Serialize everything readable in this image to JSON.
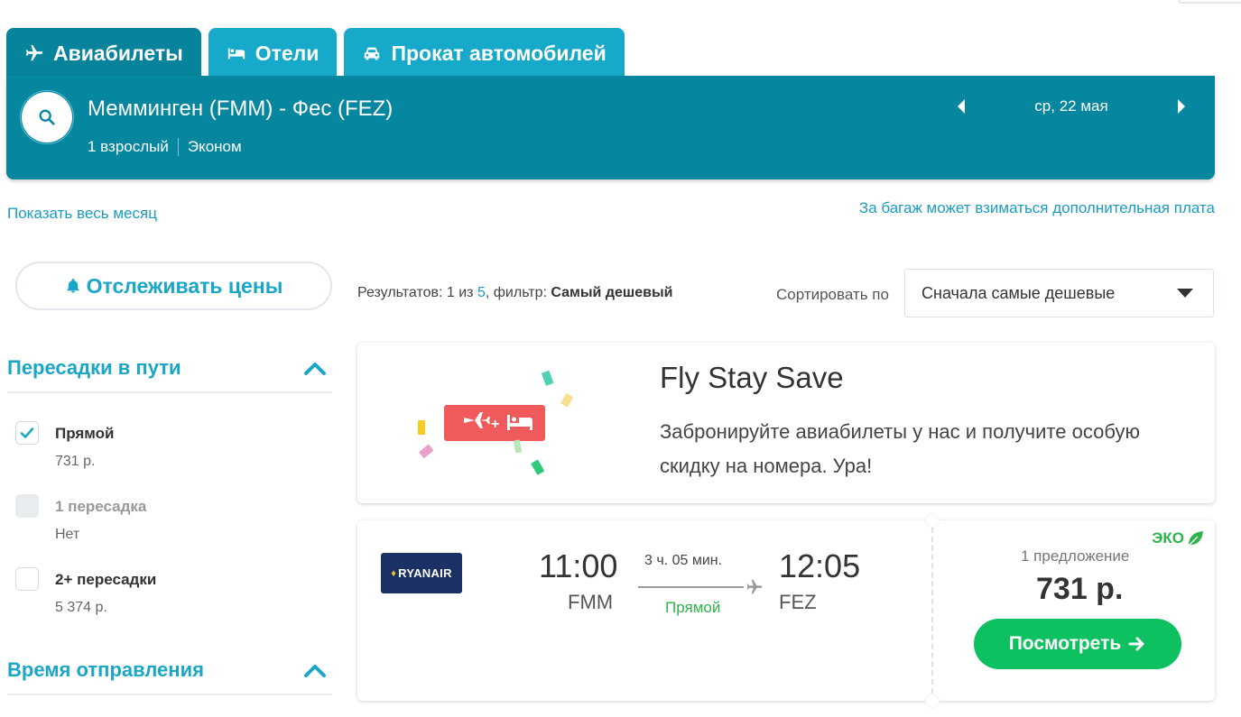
{
  "tabs": [
    {
      "label": "Авиабилеты",
      "icon": "plane-icon",
      "active": true
    },
    {
      "label": "Отели",
      "icon": "bed-icon",
      "active": false
    },
    {
      "label": "Прокат автомобилей",
      "icon": "car-icon",
      "active": false
    }
  ],
  "search": {
    "route": "Мемминген (FMM) - Фес (FEZ)",
    "passengers": "1 взрослый",
    "cabin": "Эконом",
    "date": "ср, 22 мая"
  },
  "links": {
    "show_month": "Показать весь месяц",
    "baggage_fee": "За багаж может взиматься дополнительная плата"
  },
  "filters": {
    "track_prices": "Отслеживать цены",
    "stops": {
      "title": "Пересадки в пути",
      "options": [
        {
          "label": "Прямой",
          "price": "731 р.",
          "checked": true,
          "disabled": false
        },
        {
          "label": "1 пересадка",
          "price": "Нет",
          "checked": false,
          "disabled": true
        },
        {
          "label": "2+ пересадки",
          "price": "5 374 р.",
          "checked": false,
          "disabled": false
        }
      ]
    },
    "departure_time": {
      "title": "Время отправления"
    }
  },
  "results": {
    "prefix": "Результатов: ",
    "shown": "1",
    "of": " из ",
    "total": "5",
    "filter_prefix": ", фильтр: ",
    "filter": "Самый дешевый"
  },
  "sort": {
    "label": "Сортировать по",
    "selected": "Сначала самые дешевые"
  },
  "promo": {
    "title": "Fly Stay Save",
    "text": "Забронируйте авиабилеты у нас и получите особую скидку на номера. Ура!",
    "plus": "+"
  },
  "flight": {
    "airline": "RYANAIR",
    "depart_time": "11:00",
    "depart_code": "FMM",
    "arrive_time": "12:05",
    "arrive_code": "FEZ",
    "duration": "3 ч. 05 мин.",
    "stops": "Прямой",
    "eco": "ЭКО",
    "offers": "1 предложение",
    "price": "731 р.",
    "cta": "Посмотреть"
  },
  "colors": {
    "header": "#07879f",
    "tab": "#17a9c9",
    "accent": "#1aa6c6",
    "cta": "#0ec160",
    "eco": "#2db34a",
    "promo_badge": "#f15a5a"
  }
}
